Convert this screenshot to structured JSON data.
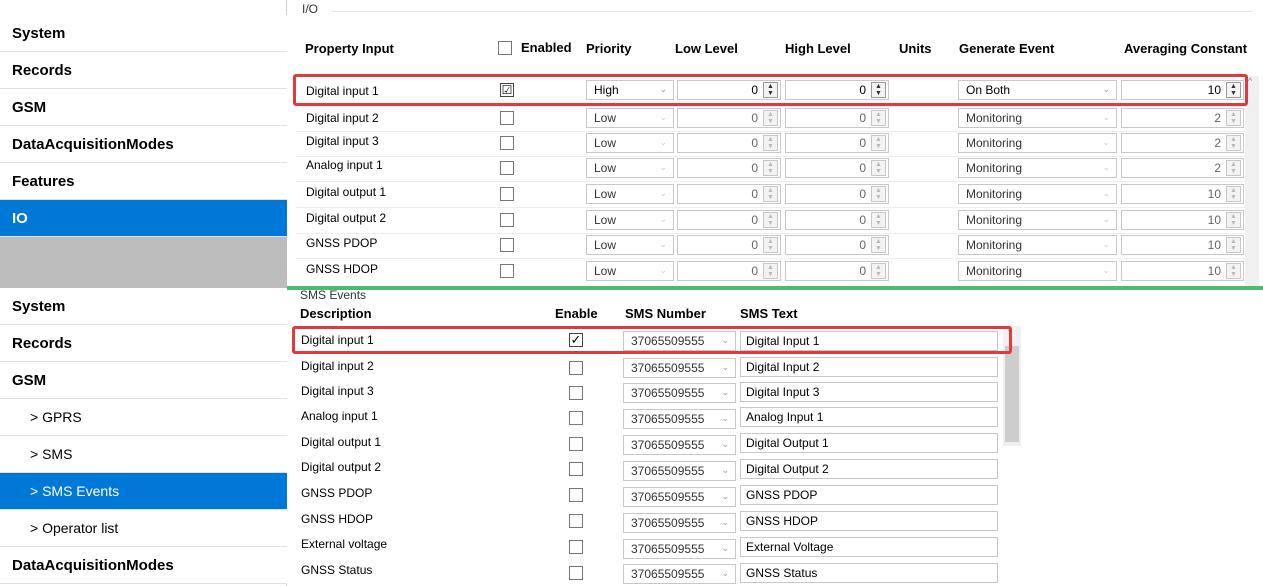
{
  "top": {
    "sidebar": [
      "System",
      "Records",
      "GSM",
      "DataAcquisitionModes",
      "Features",
      "IO"
    ],
    "group_label": "I/O",
    "headers": {
      "property": "Property Input",
      "enabled": "Enabled",
      "priority": "Priority",
      "low": "Low Level",
      "high": "High Level",
      "units": "Units",
      "event": "Generate Event",
      "avg": "Averaging Constant"
    },
    "rows": [
      {
        "name": "Digital input 1",
        "enabled": true,
        "enabled_mark": "☑",
        "priority": "High",
        "low": "0",
        "high": "0",
        "event": "On Both",
        "avg": "10"
      },
      {
        "name": "Digital input 2",
        "enabled": false,
        "enabled_mark": "",
        "priority": "Low",
        "low": "0",
        "high": "0",
        "event": "Monitoring",
        "avg": "2"
      },
      {
        "name": "Digital input 3",
        "enabled": false,
        "enabled_mark": "",
        "priority": "Low",
        "low": "0",
        "high": "0",
        "event": "Monitoring",
        "avg": "2"
      },
      {
        "name": "Analog input 1",
        "enabled": false,
        "enabled_mark": "",
        "priority": "Low",
        "low": "0",
        "high": "0",
        "event": "Monitoring",
        "avg": "2"
      },
      {
        "name": "Digital output 1",
        "enabled": false,
        "enabled_mark": "",
        "priority": "Low",
        "low": "0",
        "high": "0",
        "event": "Monitoring",
        "avg": "10"
      },
      {
        "name": "Digital output 2",
        "enabled": false,
        "enabled_mark": "",
        "priority": "Low",
        "low": "0",
        "high": "0",
        "event": "Monitoring",
        "avg": "10"
      },
      {
        "name": "GNSS PDOP",
        "enabled": false,
        "enabled_mark": "",
        "priority": "Low",
        "low": "0",
        "high": "0",
        "event": "Monitoring",
        "avg": "10"
      },
      {
        "name": "GNSS HDOP",
        "enabled": false,
        "enabled_mark": "",
        "priority": "Low",
        "low": "0",
        "high": "0",
        "event": "Monitoring",
        "avg": "10"
      }
    ]
  },
  "bottom": {
    "sidebar": [
      "System",
      "Records",
      "GSM",
      "> GPRS",
      "> SMS",
      "> SMS Events",
      "> Operator list",
      "DataAcquisitionModes"
    ],
    "group_label": "SMS Events",
    "headers": {
      "description": "Description",
      "enable": "Enable",
      "number": "SMS Number",
      "text": "SMS Text"
    },
    "rows": [
      {
        "desc": "Digital input 1",
        "enabled": true,
        "enabled_mark": "✓",
        "number": "37065509555",
        "text": "Digital Input 1"
      },
      {
        "desc": "Digital input 2",
        "enabled": false,
        "enabled_mark": "",
        "number": "37065509555",
        "text": "Digital Input 2"
      },
      {
        "desc": "Digital input 3",
        "enabled": false,
        "enabled_mark": "",
        "number": "37065509555",
        "text": "Digital Input 3"
      },
      {
        "desc": "Analog input 1",
        "enabled": false,
        "enabled_mark": "",
        "number": "37065509555",
        "text": "Analog Input 1"
      },
      {
        "desc": "Digital output 1",
        "enabled": false,
        "enabled_mark": "",
        "number": "37065509555",
        "text": "Digital Output 1"
      },
      {
        "desc": "Digital output 2",
        "enabled": false,
        "enabled_mark": "",
        "number": "37065509555",
        "text": "Digital Output 2"
      },
      {
        "desc": "GNSS PDOP",
        "enabled": false,
        "enabled_mark": "",
        "number": "37065509555",
        "text": "GNSS PDOP"
      },
      {
        "desc": "GNSS HDOP",
        "enabled": false,
        "enabled_mark": "",
        "number": "37065509555",
        "text": "GNSS HDOP"
      },
      {
        "desc": "External voltage",
        "enabled": false,
        "enabled_mark": "",
        "number": "37065509555",
        "text": "External Voltage"
      },
      {
        "desc": "GNSS Status",
        "enabled": false,
        "enabled_mark": "",
        "number": "37065509555",
        "text": "GNSS Status"
      }
    ]
  },
  "icons": {
    "spin_up": "▲",
    "spin_down": "▼",
    "dropdown": "⌄",
    "scroll_up": "^"
  },
  "colors": {
    "selection": "#0078d7",
    "highlight_box": "#e03a3e",
    "divider": "#4cbb6a"
  }
}
